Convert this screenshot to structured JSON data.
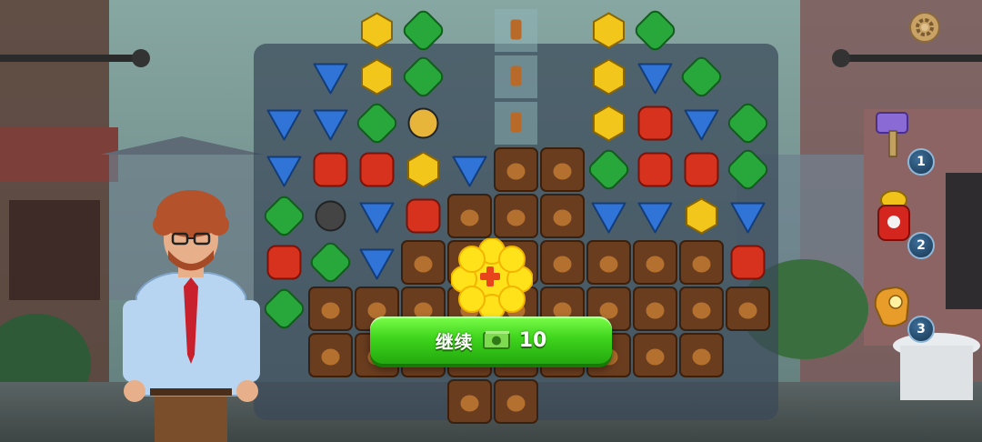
{
  "game": {
    "continue_button": {
      "label": "继续",
      "cost": "10",
      "currency_icon": "cash-icon"
    },
    "plus_button": {
      "icon": "plus-icon",
      "color": "#ffe21a"
    },
    "settings": {
      "icon": "gear-icon"
    },
    "boosters": [
      {
        "name": "hammer",
        "icon": "hammer-icon",
        "count": "1"
      },
      {
        "name": "fire-hydrant",
        "icon": "fire-hydrant-icon",
        "count": "2"
      },
      {
        "name": "glove",
        "icon": "glove-icon",
        "count": "3"
      }
    ],
    "colors": {
      "blue": "#2f74d6",
      "green": "#28a83a",
      "yellow": "#f3c61b",
      "red": "#d6321e",
      "board": "#3a4a5a",
      "button": "#3fd41d"
    }
  }
}
